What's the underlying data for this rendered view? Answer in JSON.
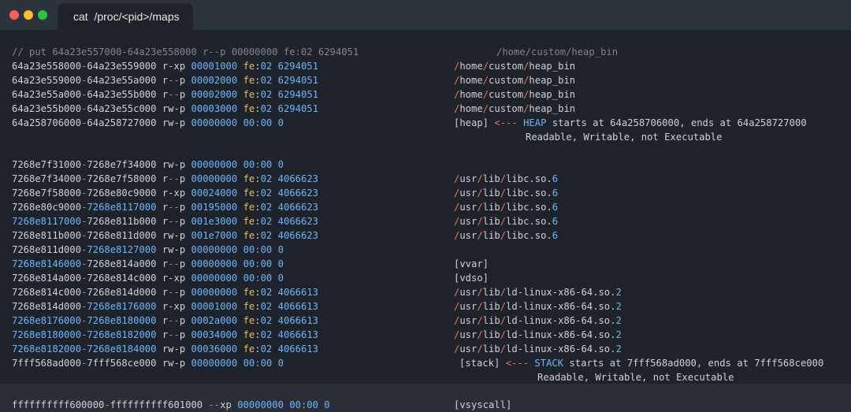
{
  "window": {
    "tab_title": "cat  /proc/<pid>/maps"
  },
  "terminal": {
    "comment": {
      "left": "// put 64a23e557000-64a23e558000 r--p 00000000 fe:02 6294051",
      "right": "/home/custom/heap_bin"
    },
    "lines": [
      {
        "start": "64a23e558000",
        "end": "64a23e559000",
        "perms": "r-xp",
        "offset": "00001000",
        "dev_major": "fe",
        "dev_minor": "02",
        "inode": "6294051",
        "path": "/home/custom/heap_bin",
        "path_type": "file",
        "start_hl": false,
        "end_hl": false
      },
      {
        "start": "64a23e559000",
        "end": "64a23e55a000",
        "perms": "r--p",
        "offset": "00002000",
        "dev_major": "fe",
        "dev_minor": "02",
        "inode": "6294051",
        "path": "/home/custom/heap_bin",
        "path_type": "file",
        "start_hl": false,
        "end_hl": false
      },
      {
        "start": "64a23e55a000",
        "end": "64a23e55b000",
        "perms": "r--p",
        "offset": "00002000",
        "dev_major": "fe",
        "dev_minor": "02",
        "inode": "6294051",
        "path": "/home/custom/heap_bin",
        "path_type": "file",
        "start_hl": false,
        "end_hl": false
      },
      {
        "start": "64a23e55b000",
        "end": "64a23e55c000",
        "perms": "rw-p",
        "offset": "00003000",
        "dev_major": "fe",
        "dev_minor": "02",
        "inode": "6294051",
        "path": "/home/custom/heap_bin",
        "path_type": "file",
        "start_hl": false,
        "end_hl": false
      },
      {
        "start": "64a258706000",
        "end": "64a258727000",
        "perms": "rw-p",
        "offset": "00000000",
        "dev_major": "00",
        "dev_minor": "00",
        "inode": "0",
        "path": "[heap]",
        "path_type": "special",
        "start_hl": false,
        "end_hl": false,
        "annotation": {
          "arrow": "<---",
          "keyword": "HEAP",
          "text": " starts at 64a258706000, ends at 64a258727000",
          "line2": "Readable, Writable, not Executable"
        }
      },
      {
        "start": "7268e7f31000",
        "end": "7268e7f34000",
        "perms": "rw-p",
        "offset": "00000000",
        "dev_major": "00",
        "dev_minor": "00",
        "inode": "0",
        "path": "",
        "path_type": "none",
        "start_hl": false,
        "end_hl": false
      },
      {
        "start": "7268e7f34000",
        "end": "7268e7f58000",
        "perms": "r--p",
        "offset": "00000000",
        "dev_major": "fe",
        "dev_minor": "02",
        "inode": "4066623",
        "path": "/usr/lib/libc.so.6",
        "path_type": "file",
        "start_hl": false,
        "end_hl": false
      },
      {
        "start": "7268e7f58000",
        "end": "7268e80c9000",
        "perms": "r-xp",
        "offset": "00024000",
        "dev_major": "fe",
        "dev_minor": "02",
        "inode": "4066623",
        "path": "/usr/lib/libc.so.6",
        "path_type": "file",
        "start_hl": false,
        "end_hl": false
      },
      {
        "start": "7268e80c9000",
        "end": "7268e8117000",
        "perms": "r--p",
        "offset": "00195000",
        "dev_major": "fe",
        "dev_minor": "02",
        "inode": "4066623",
        "path": "/usr/lib/libc.so.6",
        "path_type": "file",
        "start_hl": false,
        "end_hl": true
      },
      {
        "start": "7268e8117000",
        "end": "7268e811b000",
        "perms": "r--p",
        "offset": "001e3000",
        "dev_major": "fe",
        "dev_minor": "02",
        "inode": "4066623",
        "path": "/usr/lib/libc.so.6",
        "path_type": "file",
        "start_hl": true,
        "end_hl": false
      },
      {
        "start": "7268e811b000",
        "end": "7268e811d000",
        "perms": "rw-p",
        "offset": "001e7000",
        "dev_major": "fe",
        "dev_minor": "02",
        "inode": "4066623",
        "path": "/usr/lib/libc.so.6",
        "path_type": "file",
        "start_hl": false,
        "end_hl": false
      },
      {
        "start": "7268e811d000",
        "end": "7268e8127000",
        "perms": "rw-p",
        "offset": "00000000",
        "dev_major": "00",
        "dev_minor": "00",
        "inode": "0",
        "path": "",
        "path_type": "none",
        "start_hl": false,
        "end_hl": true
      },
      {
        "start": "7268e8146000",
        "end": "7268e814a000",
        "perms": "r--p",
        "offset": "00000000",
        "dev_major": "00",
        "dev_minor": "00",
        "inode": "0",
        "path": "[vvar]",
        "path_type": "special",
        "start_hl": true,
        "end_hl": false
      },
      {
        "start": "7268e814a000",
        "end": "7268e814c000",
        "perms": "r-xp",
        "offset": "00000000",
        "dev_major": "00",
        "dev_minor": "00",
        "inode": "0",
        "path": "[vdso]",
        "path_type": "special",
        "start_hl": false,
        "end_hl": false
      },
      {
        "start": "7268e814c000",
        "end": "7268e814d000",
        "perms": "r--p",
        "offset": "00000000",
        "dev_major": "fe",
        "dev_minor": "02",
        "inode": "4066613",
        "path": "/usr/lib/ld-linux-x86-64.so.2",
        "path_type": "file",
        "start_hl": false,
        "end_hl": false
      },
      {
        "start": "7268e814d000",
        "end": "7268e8176000",
        "perms": "r-xp",
        "offset": "00001000",
        "dev_major": "fe",
        "dev_minor": "02",
        "inode": "4066613",
        "path": "/usr/lib/ld-linux-x86-64.so.2",
        "path_type": "file",
        "start_hl": false,
        "end_hl": true
      },
      {
        "start": "7268e8176000",
        "end": "7268e8180000",
        "perms": "r--p",
        "offset": "0002a000",
        "dev_major": "fe",
        "dev_minor": "02",
        "inode": "4066613",
        "path": "/usr/lib/ld-linux-x86-64.so.2",
        "path_type": "file",
        "start_hl": true,
        "end_hl": true
      },
      {
        "start": "7268e8180000",
        "end": "7268e8182000",
        "perms": "r--p",
        "offset": "00034000",
        "dev_major": "fe",
        "dev_minor": "02",
        "inode": "4066613",
        "path": "/usr/lib/ld-linux-x86-64.so.2",
        "path_type": "file",
        "start_hl": true,
        "end_hl": true
      },
      {
        "start": "7268e8182000",
        "end": "7268e8184000",
        "perms": "rw-p",
        "offset": "00036000",
        "dev_major": "fe",
        "dev_minor": "02",
        "inode": "4066613",
        "path": "/usr/lib/ld-linux-x86-64.so.2",
        "path_type": "file",
        "start_hl": true,
        "end_hl": true
      },
      {
        "start": "7fff568ad000",
        "end": "7fff568ce000",
        "perms": "rw-p",
        "offset": "00000000",
        "dev_major": "00",
        "dev_minor": "00",
        "inode": "0",
        "path": "[stack]",
        "path_type": "special",
        "start_hl": false,
        "end_hl": false,
        "annotation": {
          "arrow": "<---",
          "keyword": "STACK",
          "text": " starts at 7fff568ad000, ends at 7fff568ce000",
          "line2": "Readable, Writable, not Executable"
        }
      },
      {
        "start": "ffffffffff600000",
        "end": "ffffffffff601000",
        "perms": "--xp",
        "offset": "00000000",
        "dev_major": "00",
        "dev_minor": "00",
        "inode": "0",
        "path": "[vsyscall]",
        "path_type": "special",
        "start_hl": false,
        "end_hl": false
      }
    ]
  },
  "colors": {
    "background": "#1e2329",
    "titlebar": "#2d333b",
    "text": "#cfd3d8",
    "comment": "#7f8791",
    "number_blue": "#6cb6ff",
    "accent_red": "#f47067",
    "device_yellow": "#e0c060"
  }
}
